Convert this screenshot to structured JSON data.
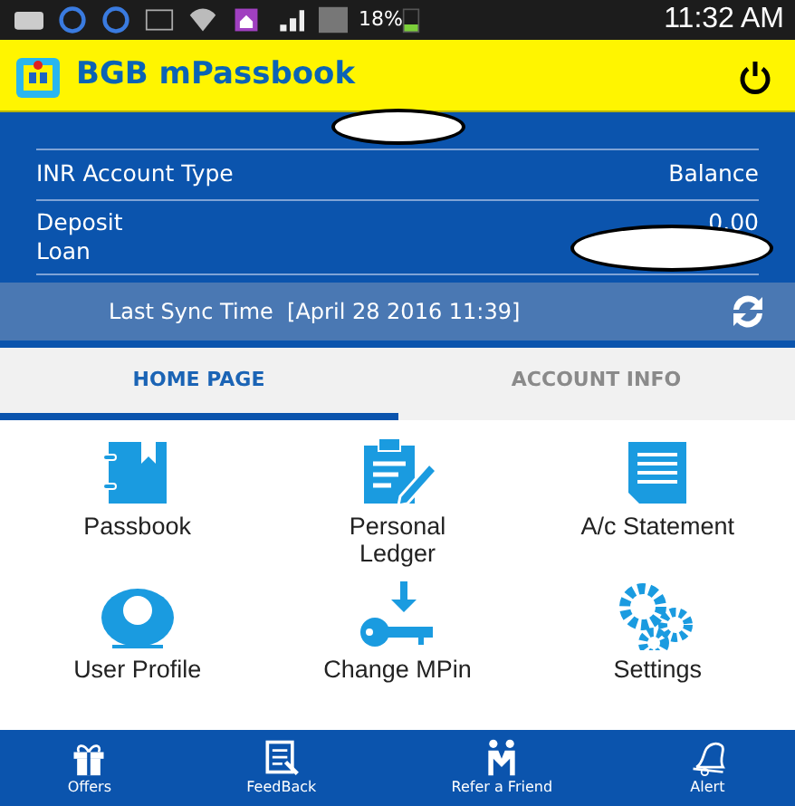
{
  "status_bar": {
    "battery": "18%",
    "time": "11:32 AM"
  },
  "header": {
    "title": "BGB mPassbook"
  },
  "accounts": {
    "columns": [
      "INR Account Type",
      "Balance"
    ],
    "rows": [
      {
        "type": "Deposit",
        "balance": "0.00"
      },
      {
        "type": "Loan"
      }
    ]
  },
  "sync": {
    "label": "Last Sync Time  [April 28 2016 11:39]"
  },
  "tabs": [
    {
      "label": "HOME PAGE",
      "selected": true
    },
    {
      "label": "ACCOUNT INFO",
      "selected": false
    }
  ],
  "tiles": [
    {
      "label": "Passbook",
      "kind": "book"
    },
    {
      "label": "Personal Ledger",
      "kind": "ledger"
    },
    {
      "label": "A/c Statement",
      "kind": "statement"
    },
    {
      "label": "User Profile",
      "kind": "user"
    },
    {
      "label": "Change MPin",
      "kind": "key"
    },
    {
      "label": "Settings",
      "kind": "gears"
    }
  ],
  "bottom_nav": [
    {
      "label": "Offers",
      "kind": "gift"
    },
    {
      "label": "FeedBack",
      "kind": "feedback"
    },
    {
      "label": "Refer a Friend",
      "kind": "people"
    },
    {
      "label": "Alert",
      "kind": "bell"
    }
  ]
}
